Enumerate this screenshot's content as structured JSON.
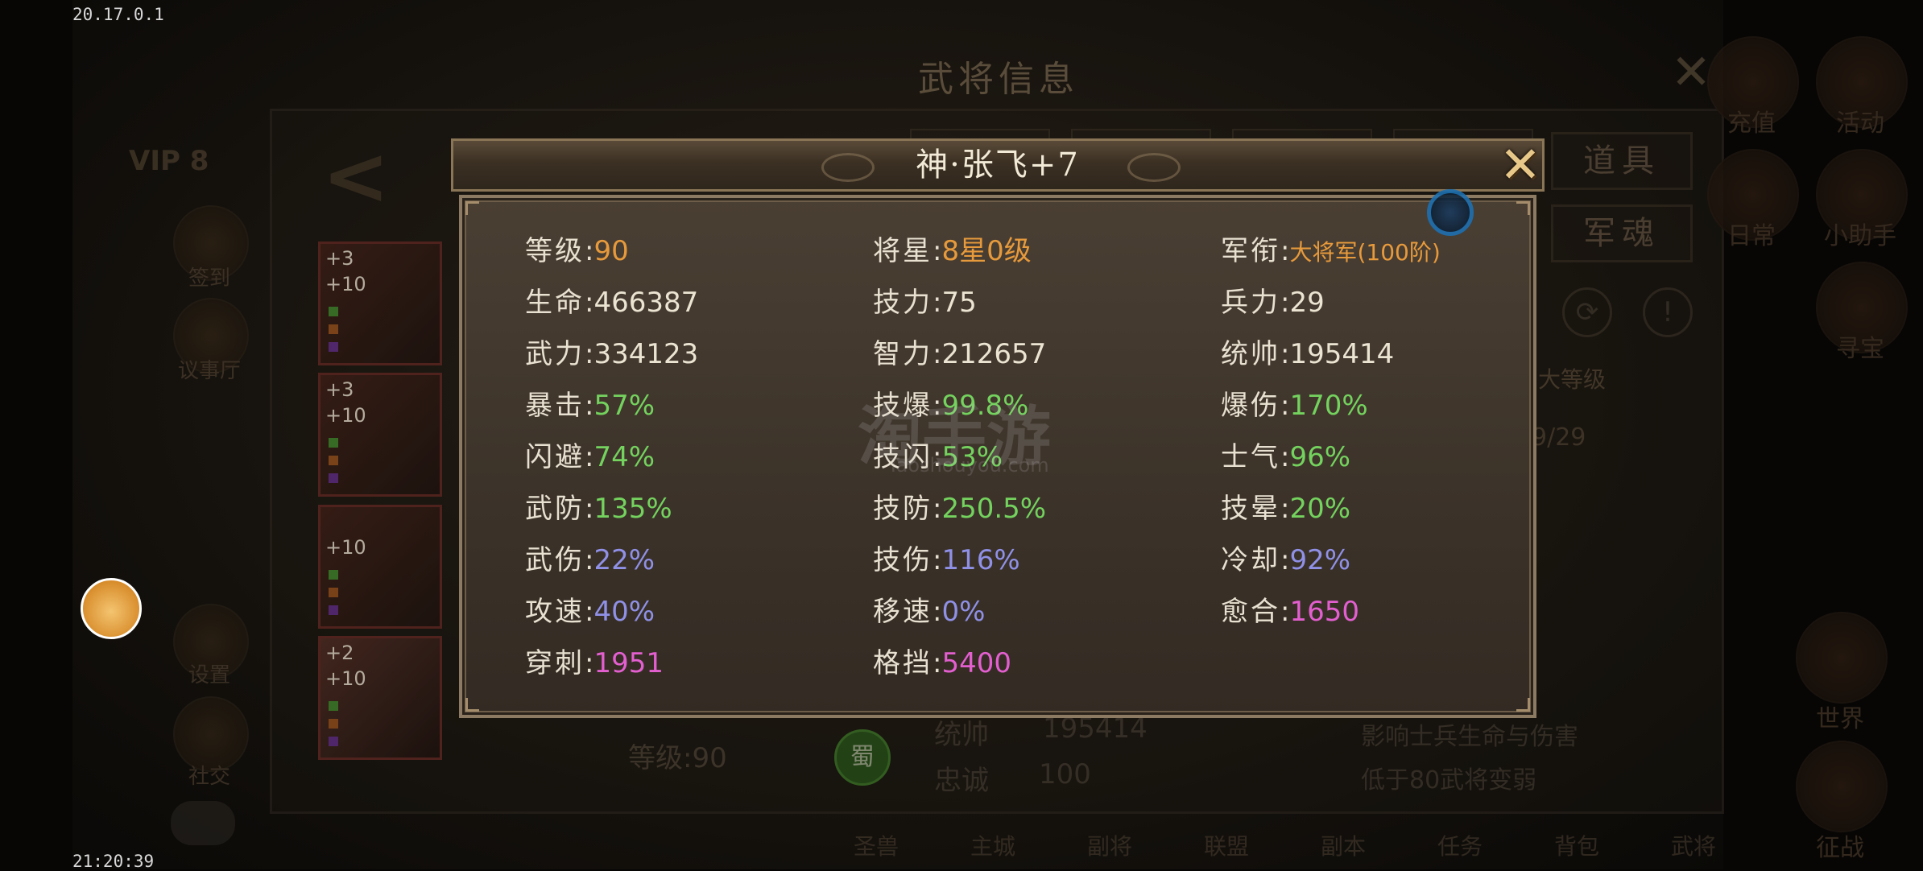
{
  "system": {
    "version": "20.17.0.1",
    "clock": "21:20:39"
  },
  "background": {
    "window_title": "武将信息",
    "vip": "VIP 8",
    "left_menu": [
      "签到",
      "议事厅",
      "设置",
      "社交"
    ],
    "side_buttons": [
      "道具",
      "军魂"
    ],
    "right_menu": [
      "充值",
      "活动",
      "日常",
      "小助手",
      "寻宝",
      "世界",
      "征战"
    ],
    "max_level_label": "大等级",
    "bg_progress": "9/29",
    "equipment": [
      {
        "top_badge": "+3",
        "bottom_badge": "+10"
      },
      {
        "top_badge": "+3",
        "bottom_badge": "+10"
      },
      {
        "top_badge": "",
        "bottom_badge": "+10"
      },
      {
        "top_badge": "+2",
        "bottom_badge": "+10"
      }
    ],
    "hero_level": "等级:90",
    "faction": "蜀",
    "stats": [
      {
        "label": "统帅",
        "value": "195414"
      },
      {
        "label": "忠诚",
        "value": "100"
      }
    ],
    "notes": [
      "影响士兵生命与伤害",
      "低于80武将变弱"
    ],
    "bottom_nav": [
      "圣兽",
      "主城",
      "副将",
      "联盟",
      "副本",
      "任务",
      "背包",
      "武将"
    ]
  },
  "dialog": {
    "title": "神·张飞+7",
    "close_icon": "x-close-icon",
    "stats": [
      {
        "label": "等级",
        "value": "90",
        "color": "orange"
      },
      {
        "label": "将星",
        "value": "8星0级",
        "color": "orange"
      },
      {
        "label": "军衔",
        "value": "大将军(100阶)",
        "color": "orange"
      },
      {
        "label": "生命",
        "value": "466387",
        "color": "white"
      },
      {
        "label": "技力",
        "value": "75",
        "color": "white"
      },
      {
        "label": "兵力",
        "value": "29",
        "color": "white"
      },
      {
        "label": "武力",
        "value": "334123",
        "color": "white"
      },
      {
        "label": "智力",
        "value": "212657",
        "color": "white"
      },
      {
        "label": "统帅",
        "value": "195414",
        "color": "white"
      },
      {
        "label": "暴击",
        "value": "57%",
        "color": "green"
      },
      {
        "label": "技爆",
        "value": "99.8%",
        "color": "green"
      },
      {
        "label": "爆伤",
        "value": "170%",
        "color": "green"
      },
      {
        "label": "闪避",
        "value": "74%",
        "color": "green"
      },
      {
        "label": "技闪",
        "value": "53%",
        "color": "green"
      },
      {
        "label": "士气",
        "value": "96%",
        "color": "green"
      },
      {
        "label": "武防",
        "value": "135%",
        "color": "green"
      },
      {
        "label": "技防",
        "value": "250.5%",
        "color": "green"
      },
      {
        "label": "技晕",
        "value": "20%",
        "color": "green"
      },
      {
        "label": "武伤",
        "value": "22%",
        "color": "blue"
      },
      {
        "label": "技伤",
        "value": "116%",
        "color": "blue"
      },
      {
        "label": "冷却",
        "value": "92%",
        "color": "blue"
      },
      {
        "label": "攻速",
        "value": "40%",
        "color": "blue"
      },
      {
        "label": "移速",
        "value": "0%",
        "color": "blue"
      },
      {
        "label": "愈合",
        "value": "1650",
        "color": "pink"
      },
      {
        "label": "穿刺",
        "value": "1951",
        "color": "pink"
      },
      {
        "label": "格挡",
        "value": "5400",
        "color": "pink"
      }
    ]
  },
  "watermark": {
    "main": "淘手游",
    "sub": "Taoshouyou.com"
  },
  "colors": {
    "orange": "#e79a3c",
    "white": "#ece4d2",
    "green": "#74d25e",
    "blue": "#8f90e6",
    "pink": "#e35fd0"
  }
}
